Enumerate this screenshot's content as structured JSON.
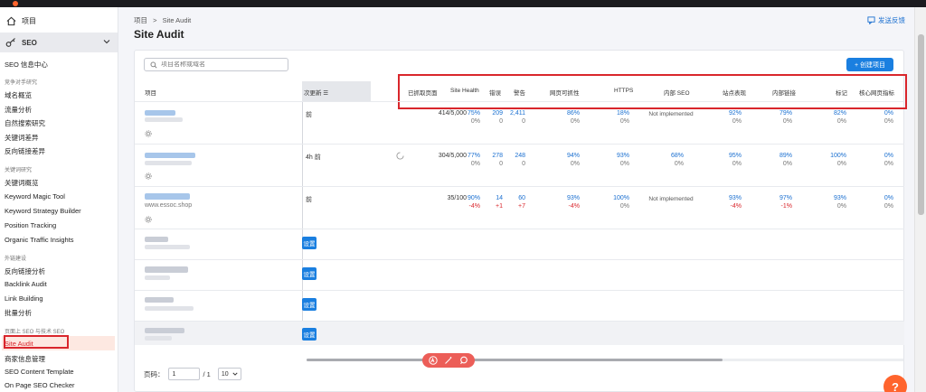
{
  "sidebar": {
    "projects_label": "项目",
    "seo_label": "SEO",
    "items": {
      "seo_info": "SEO 信息中心",
      "section_competitive": "竞争对手研究",
      "domain_overview": "域名概览",
      "traffic_analysis": "流量分析",
      "organic_research": "自然搜索研究",
      "keyword_gap": "关键词差异",
      "backlink_gap": "反向链接差异",
      "section_keyword": "关键词研究",
      "keyword_overview": "关键词概览",
      "keyword_magic": "Keyword Magic Tool",
      "keyword_strategy": "Keyword Strategy Builder",
      "position_tracking": "Position Tracking",
      "organic_traffic": "Organic Traffic Insights",
      "section_link": "外链建设",
      "backlink_analytics": "反向链接分析",
      "backlink_audit": "Backlink Audit",
      "link_building": "Link Building",
      "bulk_analysis": "批量分析",
      "section_onpage": "页面上 SEO 与技术 SEO",
      "site_audit": "Site Audit",
      "listing_management": "商家信息管理",
      "seo_content_template": "SEO Content Template",
      "on_page_checker": "On Page SEO Checker"
    }
  },
  "header": {
    "breadcrumb_root": "项目",
    "breadcrumb_sep": ">",
    "breadcrumb_current": "Site Audit",
    "title": "Site Audit",
    "feedback": "发送反馈"
  },
  "toolbar": {
    "search_placeholder": "项目名称或域名",
    "create_label": "+  创建项目"
  },
  "table": {
    "col_project": "项目",
    "col_updated": "次更新  ☰",
    "columns": [
      "已抓取页面",
      "Site Health",
      "错误",
      "警告",
      "网页可抓性",
      "HTTPS",
      "内部 SEO",
      "站点表现",
      "内部链接",
      "标记",
      "核心网页指标"
    ],
    "rows": [
      {
        "updated": "前",
        "crawled": "414/5,000",
        "health": "75%",
        "health_d": "0%",
        "errors": "209",
        "errors_d": "0",
        "warnings": "2,411",
        "warnings_d": "0",
        "crawl": "86%",
        "crawl_d": "0%",
        "https": "18%",
        "https_d": "0%",
        "internal_seo": "Not implemented",
        "perf": "92%",
        "perf_d": "0%",
        "links": "79%",
        "links_d": "0%",
        "markup": "82%",
        "markup_d": "0%",
        "cwv": "0%",
        "cwv_d": "0%"
      },
      {
        "updated": "4h 前",
        "crawled": "304/5,000",
        "health": "77%",
        "health_d": "0%",
        "errors": "278",
        "errors_d": "0",
        "warnings": "248",
        "warnings_d": "0",
        "crawl": "94%",
        "crawl_d": "0%",
        "https": "93%",
        "https_d": "0%",
        "internal_seo": "68%",
        "internal_seo_d": "0%",
        "perf": "95%",
        "perf_d": "0%",
        "links": "89%",
        "links_d": "0%",
        "markup": "100%",
        "markup_d": "0%",
        "cwv": "0%",
        "cwv_d": "0%"
      },
      {
        "domain": "www.essoc.shop",
        "updated": "前",
        "crawled": "35/100",
        "health": "90%",
        "health_d": "-4%",
        "errors": "14",
        "errors_d": "+1",
        "warnings": "60",
        "warnings_d": "+7",
        "crawl": "93%",
        "crawl_d": "-4%",
        "https": "100%",
        "https_d": "0%",
        "internal_seo": "Not implemented",
        "perf": "93%",
        "perf_d": "-4%",
        "links": "97%",
        "links_d": "-1%",
        "markup": "93%",
        "markup_d": "0%",
        "cwv": "0%",
        "cwv_d": "0%"
      }
    ],
    "setup_label": "设置"
  },
  "pager": {
    "label": "页码：",
    "page": "1",
    "total": "/ 1",
    "per_page": "10"
  },
  "help_label": "?",
  "colors": {
    "accent": "#1a7fe0",
    "highlight_red": "#d9262c",
    "brand_orange": "#ff642d"
  }
}
